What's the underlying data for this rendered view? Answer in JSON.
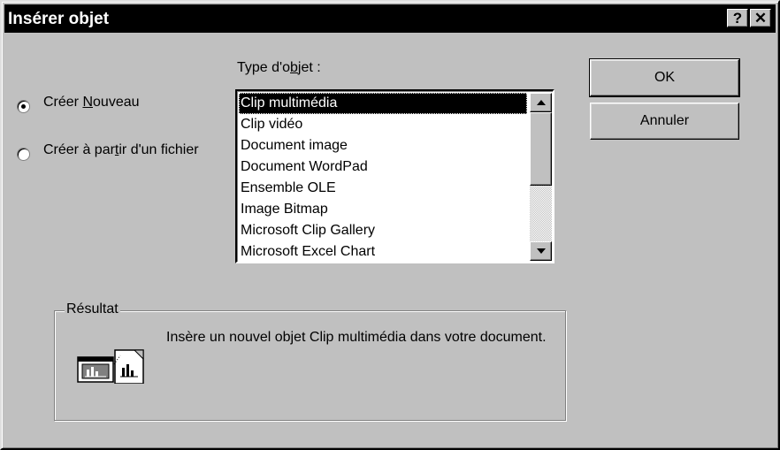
{
  "window": {
    "title": "Insérer objet",
    "help_label": "?",
    "close_label": "✕"
  },
  "object_type_label_pre": "Type d'o",
  "object_type_label_hotkey": "b",
  "object_type_label_post": "jet :",
  "options": {
    "new": {
      "pre": "Créer ",
      "hotkey": "N",
      "post": "ouveau",
      "checked": true
    },
    "from_file": {
      "pre": "Créer à par",
      "hotkey": "t",
      "post": "ir d'un fichier",
      "checked": false
    }
  },
  "object_types": [
    "Clip multimédia",
    "Clip vidéo",
    "Document image",
    "Document WordPad",
    "Ensemble OLE",
    "Image Bitmap",
    "Microsoft Clip Gallery",
    "Microsoft Excel Chart"
  ],
  "selected_index": 0,
  "buttons": {
    "ok": "OK",
    "cancel": "Annuler"
  },
  "result": {
    "legend": "Résultat",
    "text": "Insère un nouvel objet Clip multimédia dans votre document.",
    "icon": "insert-object-result-icon"
  }
}
